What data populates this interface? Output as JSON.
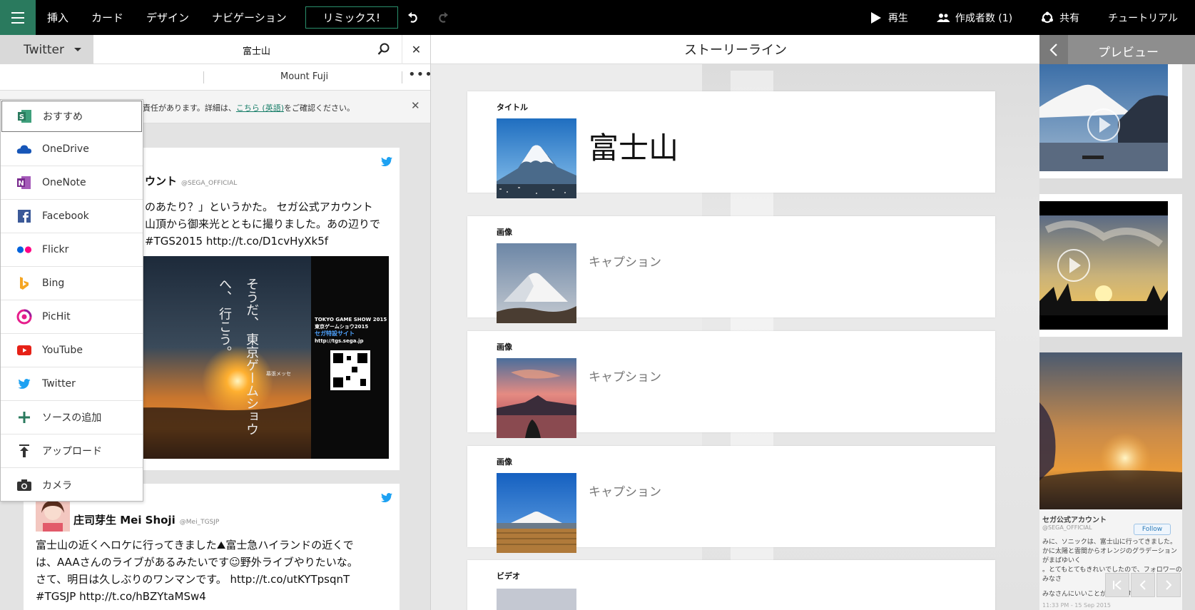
{
  "topbar": {
    "menu": [
      "挿入",
      "カード",
      "デザイン",
      "ナビゲーション"
    ],
    "remix": "リミックス!",
    "play": "再生",
    "authors": "作成者数 (1)",
    "share": "共有",
    "tutorial": "チュートリアル"
  },
  "left": {
    "source": "Twitter",
    "query": "富士山",
    "filter_tab": "Mount Fuji",
    "notice_text": "責任があります。詳細は、",
    "notice_link": "こちら (英語)",
    "notice_tail": "をご確認ください。"
  },
  "source_menu": [
    {
      "label": "おすすめ",
      "icon": "sway-icon",
      "color": "#2a7a5e"
    },
    {
      "label": "OneDrive",
      "icon": "onedrive-icon",
      "color": "#1656b8"
    },
    {
      "label": "OneNote",
      "icon": "onenote-icon",
      "color": "#7a2c8f"
    },
    {
      "label": "Facebook",
      "icon": "facebook-icon",
      "color": "#3b5998"
    },
    {
      "label": "Flickr",
      "icon": "flickr-icon",
      "color": "#ff0084"
    },
    {
      "label": "Bing",
      "icon": "bing-icon",
      "color": "#f5a623"
    },
    {
      "label": "PicHit",
      "icon": "pichit-icon",
      "color": "#e61e8c"
    },
    {
      "label": "YouTube",
      "icon": "youtube-icon",
      "color": "#e62117"
    },
    {
      "label": "Twitter",
      "icon": "twitter-icon",
      "color": "#1da1f2"
    },
    {
      "label": "ソースの追加",
      "icon": "plus-icon",
      "color": "#2a7a5e"
    },
    {
      "label": "アップロード",
      "icon": "upload-icon",
      "color": "#333333"
    },
    {
      "label": "カメラ",
      "icon": "camera-icon",
      "color": "#333333"
    }
  ],
  "tweets": [
    {
      "author": "ウント",
      "handle": "@SEGA_OFFICIAL",
      "lines": [
        "のあたり？」というかた。 セガ公式アカウント",
        "山頂から御来光とともに撮りました。あの辺りで",
        "#TGS2015 http://t.co/D1cvHyXk5f"
      ],
      "image_caption_vertical": [
        "そうだ、",
        "東京ゲームショウへ、",
        "行こう。"
      ],
      "image_side": [
        "TOKYO GAME SHOW 2015",
        "東京ゲームショウ2015",
        "セガ特設サイト",
        "http://tgs.sega.jp"
      ],
      "image_small": "幕張メッセ"
    },
    {
      "author": "庄司芽生 Mei Shoji",
      "handle": "@Mei_TGSJP",
      "lines": [
        "富士山の近くへロケに行ってきました⛰富士急ハイランドの近くで",
        "は、AAAさんのライブがあるみたいです☺野外ライブやりたいな。",
        "さて、明日は久しぶりのワンマンです。 http://t.co/utKYTpsqnT",
        "#TGSJP http://t.co/hBZYtaMSw4"
      ]
    }
  ],
  "story": {
    "header": "ストーリーライン",
    "cards": [
      {
        "label": "タイトル",
        "text": "富士山"
      },
      {
        "label": "画像",
        "caption": "キャプション"
      },
      {
        "label": "画像",
        "caption": "キャプション"
      },
      {
        "label": "画像",
        "caption": "キャプション"
      },
      {
        "label": "ビデオ"
      }
    ]
  },
  "preview": {
    "title": "プレビュー",
    "tweet_author": "セガ公式アカウント",
    "tweet_handle": "@SEGA_OFFICIAL",
    "follow": "Follow",
    "tweet_lines": [
      "みに、ソニックは、富士山に行ってきました。",
      "かに太陽と雲間からオレンジのグラデーションがまばゆいく",
      "。とてもとてもきれいでしたので、フォロワーのみなさ",
      "みなさんにいいことがありますように！"
    ],
    "tweet_date": "11:33 PM - 15 Sep 2015"
  }
}
